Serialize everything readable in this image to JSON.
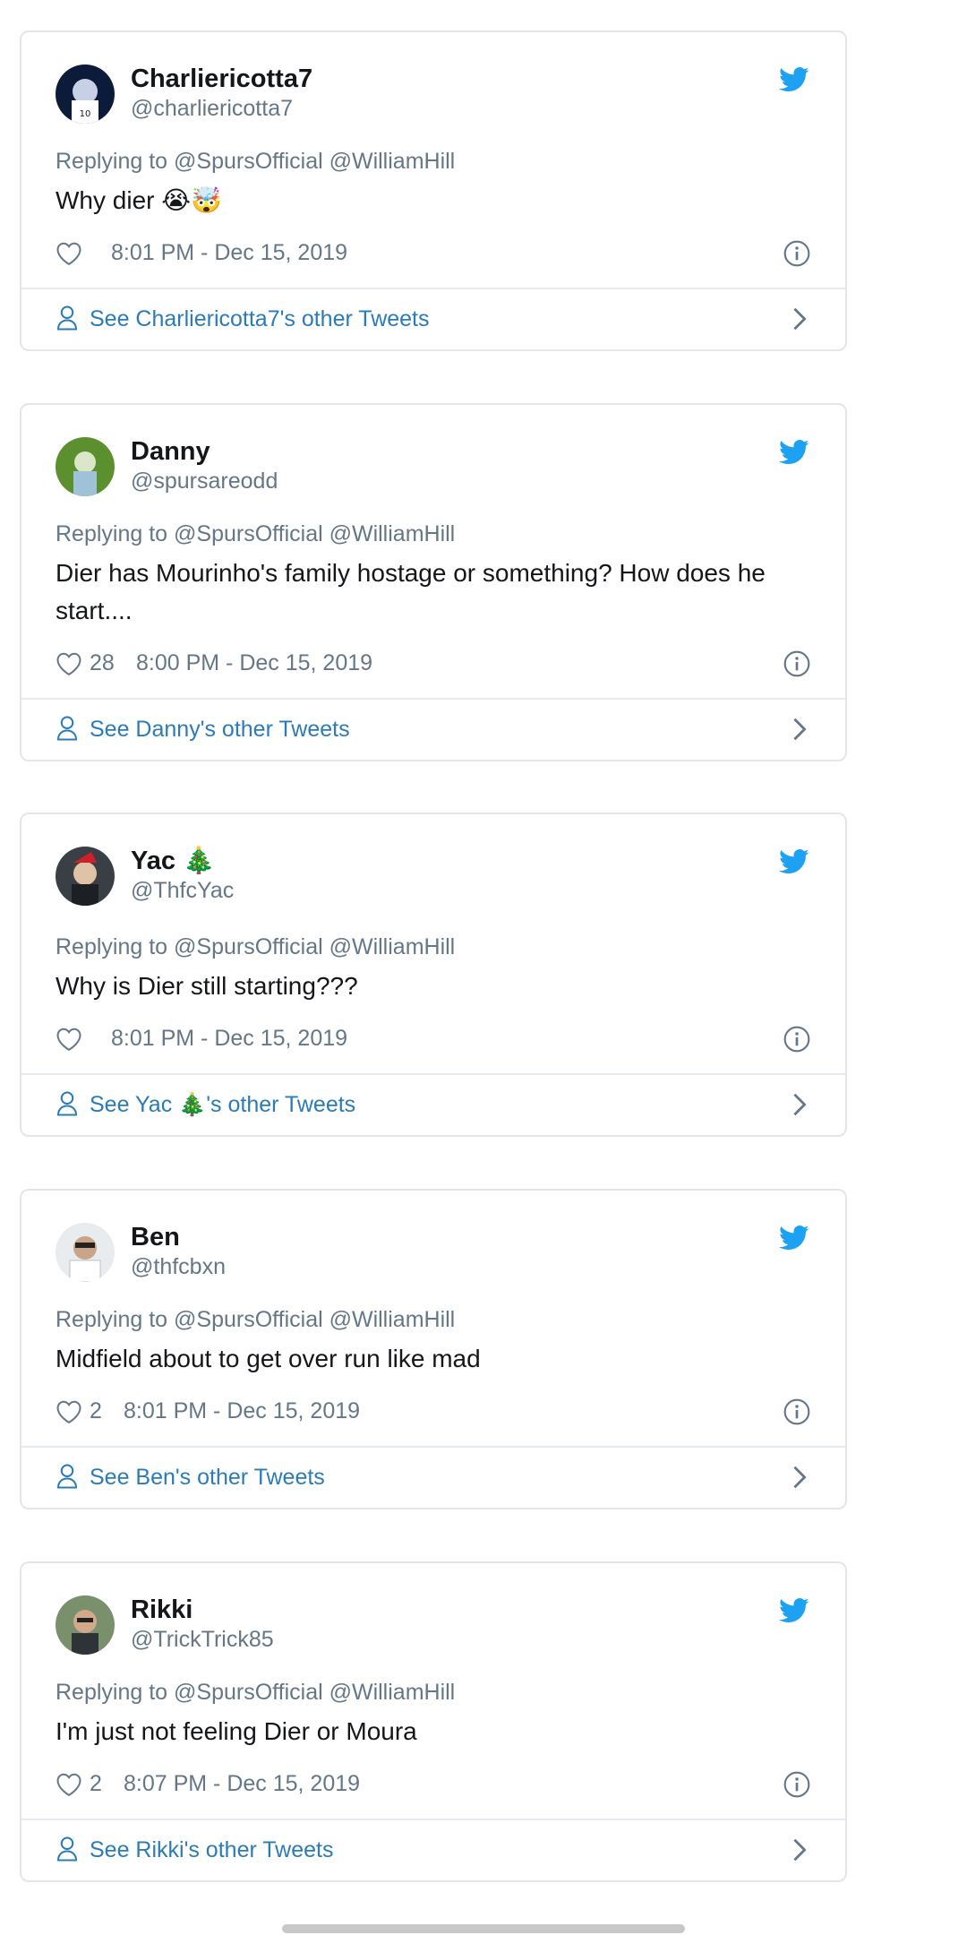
{
  "tweets": [
    {
      "display_name": "Charliericotta7",
      "handle": "@charliericotta7",
      "replying": "Replying to @SpursOfficial @WilliamHill",
      "text": "Why dier 😭🤯",
      "likes": "",
      "time": "8:01 PM - Dec 15, 2019",
      "see_other": "See Charliericotta7's other Tweets"
    },
    {
      "display_name": "Danny",
      "handle": "@spursareodd",
      "replying": "Replying to @SpursOfficial @WilliamHill",
      "text": "Dier has Mourinho's family hostage or something? How does he start....",
      "likes": "28",
      "time": "8:00 PM - Dec 15, 2019",
      "see_other": "See Danny's other Tweets"
    },
    {
      "display_name": "Yac 🎄",
      "handle": "@ThfcYac",
      "replying": "Replying to @SpursOfficial @WilliamHill",
      "text": "Why is Dier still starting???",
      "likes": "",
      "time": "8:01 PM - Dec 15, 2019",
      "see_other": "See Yac 🎄's other Tweets"
    },
    {
      "display_name": "Ben",
      "handle": "@thfcbxn",
      "replying": "Replying to @SpursOfficial @WilliamHill",
      "text": "Midfield about to get over run like mad",
      "likes": "2",
      "time": "8:01 PM - Dec 15, 2019",
      "see_other": "See Ben's other Tweets"
    },
    {
      "display_name": "Rikki",
      "handle": "@TrickTrick85",
      "replying": "Replying to @SpursOfficial @WilliamHill",
      "text": "I'm just not feeling Dier or Moura",
      "likes": "2",
      "time": "8:07 PM - Dec 15, 2019",
      "see_other": "See Rikki's other Tweets"
    }
  ],
  "colors": {
    "twitter_blue": "#1da1f2",
    "link_blue": "#2b7bb9",
    "secondary_text": "#657786",
    "border": "#e3e6e8"
  },
  "icons": [
    "twitter-bird-icon",
    "heart-icon",
    "info-icon",
    "person-icon",
    "chevron-right-icon"
  ]
}
